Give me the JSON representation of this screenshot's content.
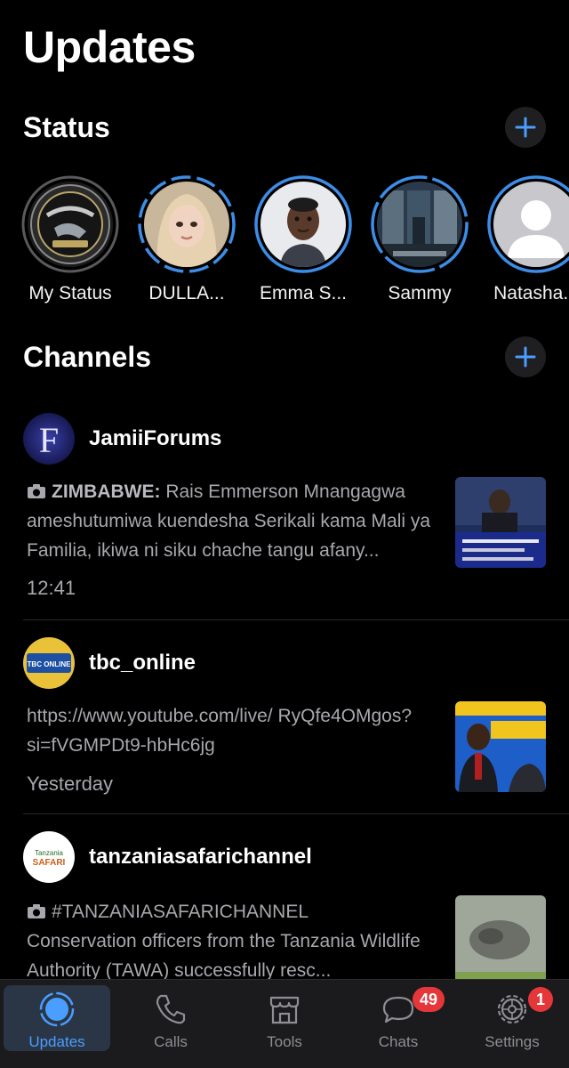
{
  "header": {
    "title": "Updates"
  },
  "status": {
    "title": "Status",
    "items": [
      {
        "name": "My Status"
      },
      {
        "name": "DULLA..."
      },
      {
        "name": "Emma S..."
      },
      {
        "name": "Sammy"
      },
      {
        "name": "Natasha..."
      }
    ]
  },
  "channels": {
    "title": "Channels",
    "items": [
      {
        "name": "JamiiForums",
        "prefix": "ZIMBABWE:",
        "text": " Rais Emmerson Mnangagwa ameshutumiwa kuendesha Serikali kama Mali ya Familia, ikiwa ni siku chache tangu afany...",
        "time": "12:41"
      },
      {
        "name": "tbc_online",
        "text": "https://www.youtube.com/live/ RyQfe4OMgos?si=fVGMPDt9-hbHc6jg",
        "time": "Yesterday"
      },
      {
        "name": "tanzaniasafarichannel",
        "prefix": "#TANZANIASAFARICHANNEL",
        "text": "Conservation officers from the Tanzania Wildlife Authority (TAWA) successfully resc..."
      }
    ]
  },
  "logos": {
    "jamii": "F",
    "tbc": "TBC ONLINE",
    "safari_top": "Tanzania",
    "safari_bottom": "SAFARI"
  },
  "tabs": [
    {
      "label": "Updates",
      "icon": "updates-icon",
      "active": true
    },
    {
      "label": "Calls",
      "icon": "phone-icon"
    },
    {
      "label": "Tools",
      "icon": "store-icon"
    },
    {
      "label": "Chats",
      "icon": "chat-bubble-icon",
      "badge": "49"
    },
    {
      "label": "Settings",
      "icon": "gear-icon",
      "badge": "1"
    }
  ],
  "colors": {
    "accent": "#4a9eff",
    "badge": "#e5373a",
    "background": "#000000",
    "tabbar": "#1b1b1d"
  }
}
